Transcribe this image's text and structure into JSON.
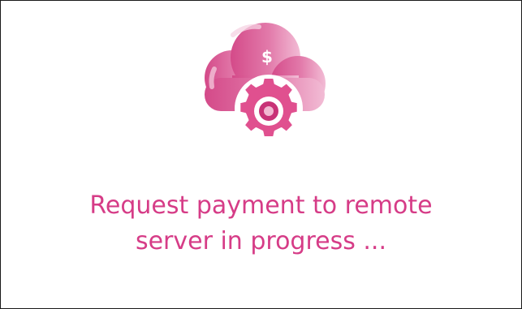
{
  "status": {
    "line1": "Request payment to remote",
    "line2": "server in progress ..."
  },
  "illustration": {
    "icon": "cloud-payment-gear-icon",
    "symbol": "$",
    "colors": {
      "cloud_dark": "#d44a89",
      "cloud_light": "#f1b8d2",
      "gear": "#e0508f",
      "accent_text": "#d63c87"
    }
  }
}
